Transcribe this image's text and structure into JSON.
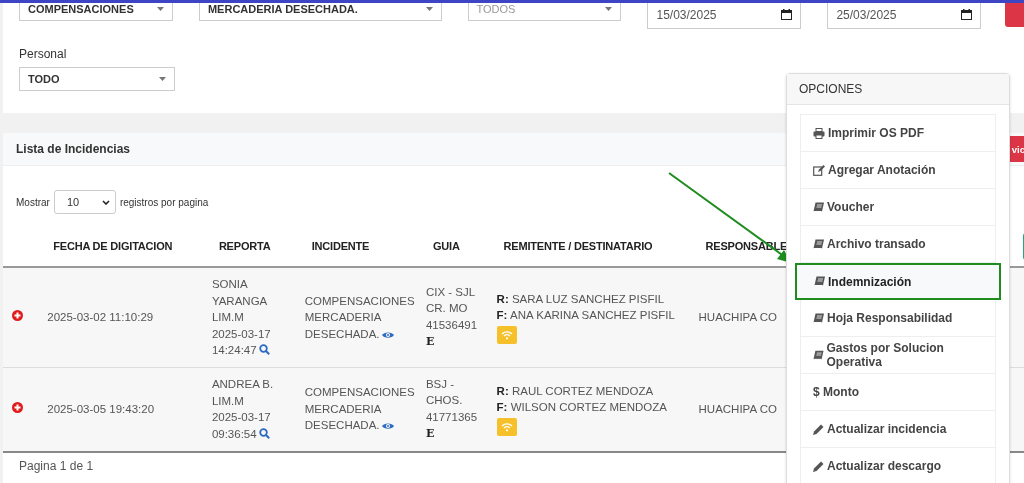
{
  "filters": [
    {
      "kind": "select",
      "value": "COMPENSACIONES"
    },
    {
      "kind": "select",
      "value": "MERCADERIA DESECHADA."
    },
    {
      "kind": "select",
      "placeholder": "TODOS"
    },
    {
      "kind": "date",
      "value": "15/03/2025"
    },
    {
      "kind": "date",
      "value": "25/03/2025"
    }
  ],
  "personal": {
    "label": "Personal",
    "value": "TODO"
  },
  "list": {
    "title": "Lista de Incidencias",
    "header_button": "vic",
    "length_before": "Mostrar",
    "page_length": "10",
    "length_after": "registros por pagina",
    "columns": [
      "FECHA DE DIGITACION",
      "REPORTA",
      "INCIDENTE",
      "GUIA",
      "REMITENTE / DESTINATARIO",
      "RESPONSABLE"
    ],
    "rows": [
      {
        "fecha": "2025-03-02 11:10:29",
        "reporta": [
          "SONIA",
          "YARANGA",
          "LIM.M",
          "2025-03-17"
        ],
        "reporta_time": "14:24:47",
        "incidente": [
          "COMPENSACIONES",
          "MERCADERIA"
        ],
        "incidente_last": "DESECHADA.",
        "guia": [
          "CIX - SJL",
          "CR. MO",
          "41536491"
        ],
        "guia_mark": "E",
        "remitente_label": "R:",
        "remitente": "SARA LUZ SANCHEZ PISFIL",
        "destinatario_label": "F:",
        "destinatario": "ANA KARINA SANCHEZ PISFIL",
        "responsable": "HUACHIPA CO"
      },
      {
        "fecha": "2025-03-05 19:43:20",
        "reporta": [
          "ANDREA B.",
          "LIM.M",
          "2025-03-17"
        ],
        "reporta_time": "09:36:54",
        "incidente": [
          "COMPENSACIONES",
          "MERCADERIA"
        ],
        "incidente_last": "DESECHADA.",
        "guia": [
          "BSJ -",
          "CHOS.",
          "41771365"
        ],
        "guia_mark": "E",
        "remitente_label": "R:",
        "remitente": "RAUL CORTEZ MENDOZA",
        "destinatario_label": "F:",
        "destinatario": "WILSON CORTEZ MENDOZA",
        "responsable": "HUACHIPA CO"
      }
    ],
    "footer": "Pagina 1 de 1"
  },
  "menu": {
    "title": "OPCIONES",
    "items": [
      {
        "kind": "print",
        "label": "Imprimir OS PDF",
        "highlighted": false
      },
      {
        "kind": "note",
        "label": "Agregar Anotación",
        "highlighted": false
      },
      {
        "kind": "document",
        "label": "Voucher",
        "highlighted": false
      },
      {
        "kind": "document",
        "label": "Archivo transado",
        "highlighted": false
      },
      {
        "kind": "document",
        "label": "Indemnización",
        "highlighted": true
      },
      {
        "kind": "document",
        "label": "Hoja Responsabilidad",
        "highlighted": false
      },
      {
        "kind": "document",
        "label": "Gastos por Solucion Operativa",
        "highlighted": false
      },
      {
        "kind": "amount",
        "label": "$ Monto",
        "highlighted": false
      },
      {
        "kind": "update",
        "label": "Actualizar incidencia",
        "highlighted": false
      },
      {
        "kind": "update",
        "label": "Actualizar descargo",
        "highlighted": false
      }
    ]
  }
}
